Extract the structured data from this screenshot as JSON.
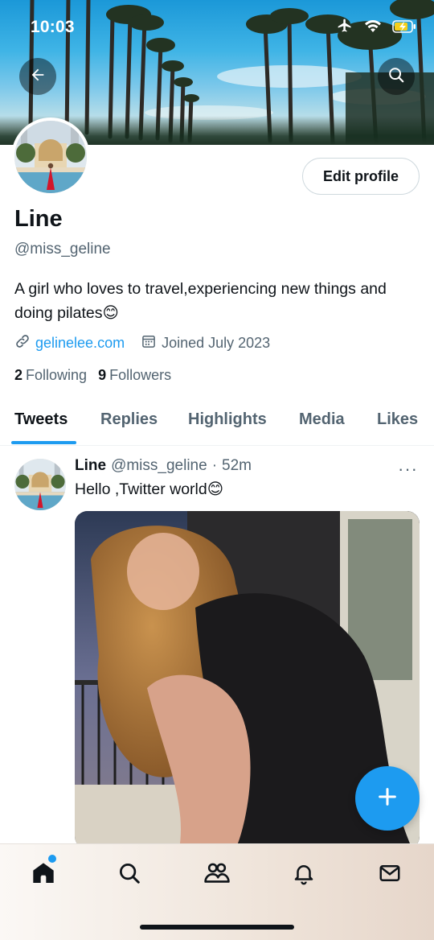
{
  "status_bar": {
    "time": "10:03"
  },
  "profile": {
    "name": "Line",
    "handle": "@miss_geline",
    "bio_text": "A girl who loves to travel,experiencing new things and doing pilates",
    "bio_emoji": "😊",
    "website": "gelinelee.com",
    "joined": "Joined July 2023",
    "following_count": "2",
    "following_label": "Following",
    "followers_count": "9",
    "followers_label": "Followers",
    "edit_button": "Edit profile"
  },
  "tabs": [
    {
      "label": "Tweets",
      "active": true
    },
    {
      "label": "Replies",
      "active": false
    },
    {
      "label": "Highlights",
      "active": false
    },
    {
      "label": "Media",
      "active": false
    },
    {
      "label": "Likes",
      "active": false
    }
  ],
  "tweet": {
    "name": "Line",
    "handle": "@miss_geline",
    "separator": "·",
    "time": "52m",
    "text": "Hello ,Twitter world",
    "emoji": "😊",
    "more": "···"
  },
  "bottom_nav": {
    "items": [
      "home-icon",
      "search-icon",
      "communities-icon",
      "notifications-icon",
      "messages-icon"
    ],
    "active": "home-icon",
    "home_has_notification": true
  },
  "colors": {
    "accent": "#1d9bf0",
    "text": "#0f1419",
    "secondary": "#536471"
  }
}
